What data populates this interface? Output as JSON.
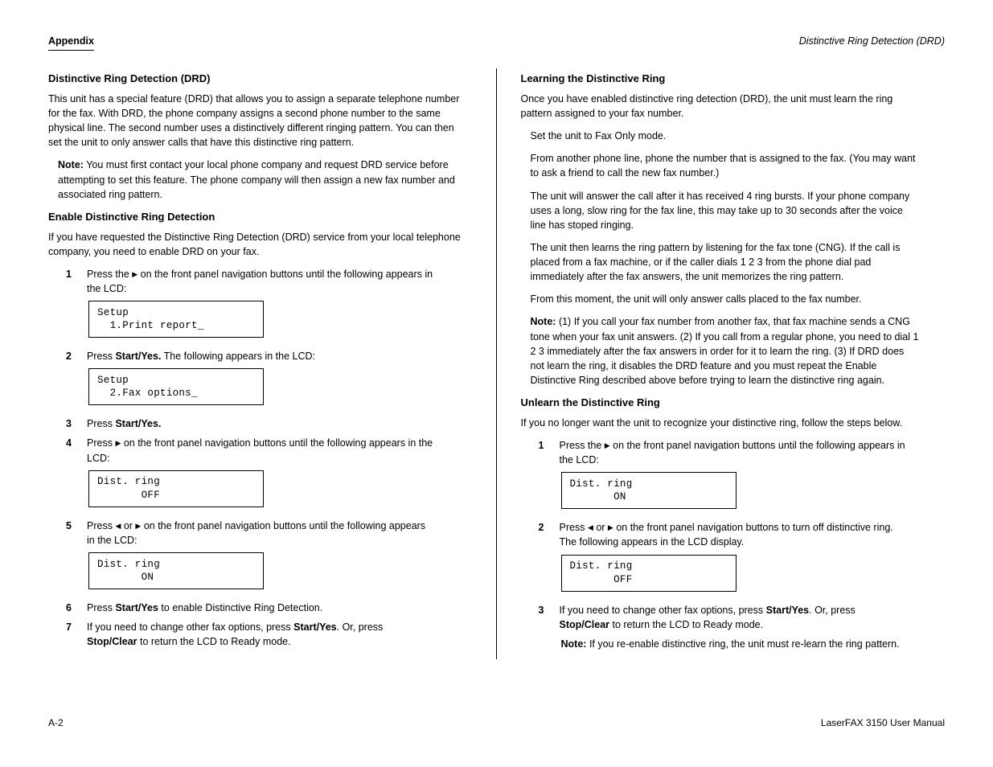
{
  "header": {
    "left": "Appendix",
    "right": "Distinctive Ring Detection (DRD)"
  },
  "left_col": {
    "h1": "Distinctive Ring Detection (DRD)",
    "p1": "This unit has a special feature (DRD) that allows you to assign a separate telephone number for the fax. With DRD, the phone company assigns a second phone number to the same physical line. The second number uses a distinctively different ringing pattern. You can then set the unit to only answer calls that have this distinctive ring pattern.",
    "note1_label": "Note:",
    "note1_text": "You must first contact your local phone company and request DRD service before attempting to set this feature. The phone company will then assign a new fax number and associated ring pattern.",
    "h2": "Enable Distinctive Ring Detection",
    "p2": "If you have requested the Distinctive Ring Detection (DRD) service from your local telephone company, you need to enable DRD on your fax.",
    "step1_num": "1",
    "step1_text_a": "Press the ",
    "step1_text_b": " on the front panel navigation buttons until the following appears in the LCD:",
    "lcd1_r1": "Setup",
    "lcd1_r2": "  1.Print report_",
    "step2_num": "2",
    "step2_text": "Press <b>Start/Yes.</b> The following appears in the LCD:",
    "lcd2_r1": "Setup",
    "lcd2_r2": "  2.Fax options_",
    "step3_num": "3",
    "step3_text": "Press <b>Start/Yes.</b>",
    "step4_num": "4",
    "step4_text_a": "Press ",
    "step4_text_b": " on the front panel navigation buttons until the following appears in the LCD:",
    "lcd3_r1": "Dist. ring",
    "lcd3_r2": "       OFF      ",
    "step5_num": "5",
    "step5_text_a": "Press ",
    "step5_text_b": " or ",
    "step5_text_c": " on the front panel navigation buttons until the following appears in the LCD:",
    "lcd4_r1": "Dist. ring",
    "lcd4_r2": "       ON       ",
    "step6_num": "6",
    "step6_text": "Press <b>Start/Yes</b> to enable Distinctive Ring Detection.",
    "step7_num": "7",
    "step7_text": "If you need to change other fax options, press <b>Start/Yes</b>. Or, press <b>Stop/Clear</b> to return the LCD to Ready mode."
  },
  "right_col": {
    "h1": "Learning the Distinctive Ring",
    "p1": "Once you have enabled distinctive ring detection (DRD), the unit must learn the ring pattern assigned to your fax number.",
    "list": [
      "Set the unit to Fax Only mode.",
      "From another phone line, phone the number that is assigned to the fax. (You may want to ask a friend to call the new fax number.)",
      "The unit will answer the call after it has received 4 ring bursts. If your phone company uses a long, slow ring for the fax line, this may take up to 30 seconds after the voice line has stoped ringing.",
      "The unit then learns the ring pattern by listening for the fax tone (CNG). If the call is placed from a fax machine, or if the caller dials 1 2 3 from the phone dial pad immediately after the fax answers, the unit memorizes the ring pattern.",
      "From this moment, the unit will only answer calls placed to the fax number."
    ],
    "note1_label": "Note:",
    "note1_text": "(1) If you call your fax number from another fax, that fax machine sends a CNG tone when your fax unit answers. (2) If you call from a regular phone, you need to dial 1 2 3 immediately after the fax answers in order for it to learn the ring. (3) If DRD does not learn the ring, it disables the DRD feature and you must repeat the Enable Distinctive Ring described above before trying to learn the distinctive ring again.",
    "h2": "Unlearn the Distinctive Ring",
    "p2": "If you no longer want the unit to recognize your distinctive ring, follow the steps below.",
    "step1_num": "1",
    "step1_text_a": "Press the ",
    "step1_text_b": " on the front panel navigation buttons until the following appears in the LCD:",
    "lcd1_r1": "Dist. ring",
    "lcd1_r2": "       ON       ",
    "step2_num": "2",
    "step2_text_a": "Press ",
    "step2_text_b": " or ",
    "step2_text_c": " on the front panel navigation buttons to turn off distinctive ring. The following appears in the LCD display.",
    "lcd2_r1": "Dist. ring",
    "lcd2_r2": "       OFF      ",
    "step3_num": "3",
    "step3_text": "If you need to change other fax options, press <b>Start/Yes</b>. Or, press <b>Stop/Clear</b> to return the LCD to Ready mode.",
    "note2_label": "Note:",
    "note2_text": "If you re-enable distinctive ring, the unit must re-learn the ring pattern."
  },
  "footer": {
    "left": "A-2",
    "right": "LaserFAX 3150 User Manual"
  }
}
